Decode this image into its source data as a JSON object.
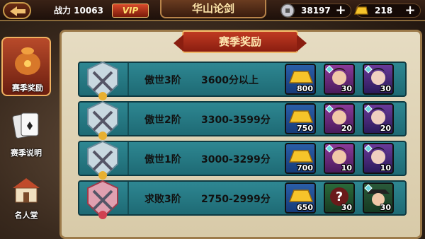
{
  "header": {
    "title": "华山论剑",
    "power_label": "战力 10063",
    "vip_label": "VIP",
    "silver": "38197",
    "gold": "218"
  },
  "sidebar": {
    "items": [
      {
        "label": "赛季奖励",
        "icon": "reward-bag-icon",
        "active": true
      },
      {
        "label": "赛季说明",
        "icon": "cards-icon",
        "active": false
      },
      {
        "label": "名人堂",
        "icon": "hall-of-fame-icon",
        "active": false
      }
    ]
  },
  "panel": {
    "title": "赛季奖励",
    "rows": [
      {
        "rank": "傲世3阶",
        "score": "3600分以上",
        "gold": "800",
        "hero1": "30",
        "hero2": "30",
        "badge_tier": "silver"
      },
      {
        "rank": "傲世2阶",
        "score": "3300-3599分",
        "gold": "750",
        "hero1": "20",
        "hero2": "20",
        "badge_tier": "silver"
      },
      {
        "rank": "傲世1阶",
        "score": "3000-3299分",
        "gold": "700",
        "hero1": "10",
        "hero2": "10",
        "badge_tier": "silver"
      },
      {
        "rank": "求败3阶",
        "score": "2750-2999分",
        "gold": "650",
        "hero1": "30",
        "hero2": "30",
        "badge_tier": "red"
      }
    ]
  },
  "colors": {
    "row_bg": "#2e8792",
    "panel_bg": "#e6dcc2",
    "ribbon": "#c03a22"
  }
}
